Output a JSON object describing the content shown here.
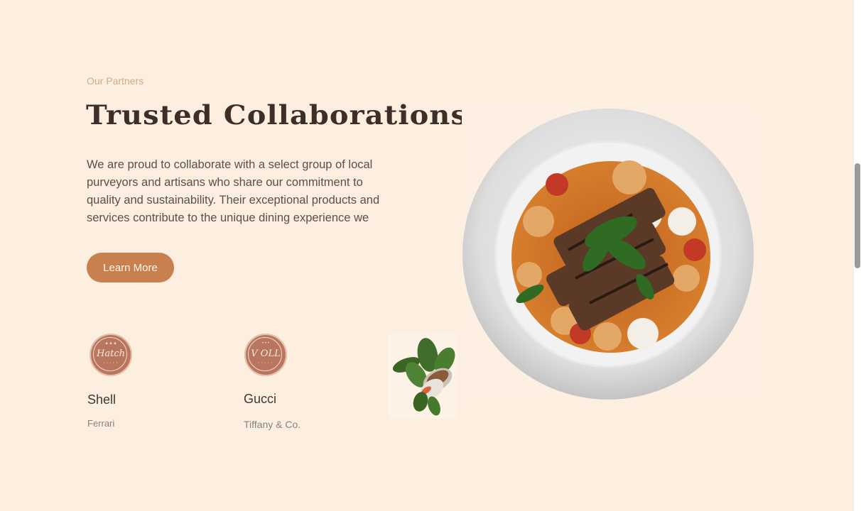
{
  "section": {
    "eyebrow": "Our Partners",
    "title": "Trusted Collaborations",
    "description": "We are proud to collaborate with a select group of local purveyors and artisans who share our commitment to quality and sustainability. Their exceptional products and services contribute to the unique dining experience we",
    "cta_label": "Learn More"
  },
  "partners": [
    {
      "logo_text": "Hatch",
      "name": "Shell",
      "subtitle": "Ferrari"
    },
    {
      "logo_text": "V OLL",
      "name": "Gucci",
      "subtitle": "Tiffany & Co."
    }
  ],
  "colors": {
    "background": "#fcefe0",
    "accent": "#c7804e",
    "title": "#3c2f2a",
    "eyebrow": "#d7a785"
  },
  "images": {
    "hero": "plated-grilled-meat-dish-photo",
    "thumbnail": "spinach-wrap-photo"
  }
}
